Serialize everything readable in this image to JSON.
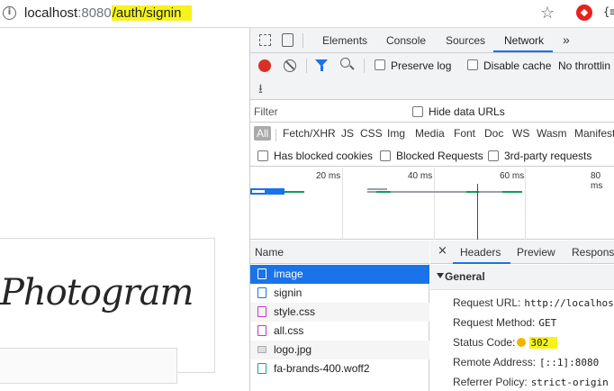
{
  "address_bar": {
    "url_host": "localhost",
    "url_port": ":8080",
    "url_path": "/auth/signin",
    "ext2_label": "{≡"
  },
  "page": {
    "logo_text": "Photogram"
  },
  "devtools": {
    "tabs": [
      "Elements",
      "Console",
      "Sources",
      "Network"
    ],
    "active_tab": "Network",
    "more_tabs": "»",
    "toolbar": {
      "preserve_log": "Preserve log",
      "disable_cache": "Disable cache",
      "throttling": "No throttlin"
    },
    "filter": {
      "placeholder": "Filter",
      "hide_data_urls": "Hide data URLs"
    },
    "types": [
      "All",
      "Fetch/XHR",
      "JS",
      "CSS",
      "Img",
      "Media",
      "Font",
      "Doc",
      "WS",
      "Wasm",
      "Manifest"
    ],
    "blocked": {
      "has_blocked_cookies": "Has blocked cookies",
      "blocked_requests": "Blocked Requests",
      "third_party": "3rd-party requests"
    },
    "timeline_ticks": [
      "20 ms",
      "40 ms",
      "60 ms",
      "80 ms"
    ],
    "name_header": "Name",
    "requests": [
      {
        "name": "image",
        "type": "doc",
        "selected": true
      },
      {
        "name": "signin",
        "type": "doc"
      },
      {
        "name": "style.css",
        "type": "css"
      },
      {
        "name": "all.css",
        "type": "css"
      },
      {
        "name": "logo.jpg",
        "type": "img"
      },
      {
        "name": "fa-brands-400.woff2",
        "type": "font"
      }
    ],
    "details": {
      "close": "×",
      "tabs": [
        "Headers",
        "Preview",
        "Response"
      ],
      "active_tab": "Headers",
      "general_label": "General",
      "headers": [
        {
          "key": "Request URL:",
          "value": "http://localhost"
        },
        {
          "key": "Request Method:",
          "value": "GET"
        },
        {
          "key": "Status Code:",
          "value": "302"
        },
        {
          "key": "Remote Address:",
          "value": "[::1]:8080"
        },
        {
          "key": "Referrer Policy:",
          "value": "strict-origin"
        }
      ]
    }
  },
  "colors": {
    "highlight": "#f6f31a",
    "accent": "#1a73e8",
    "record": "#d93025"
  }
}
